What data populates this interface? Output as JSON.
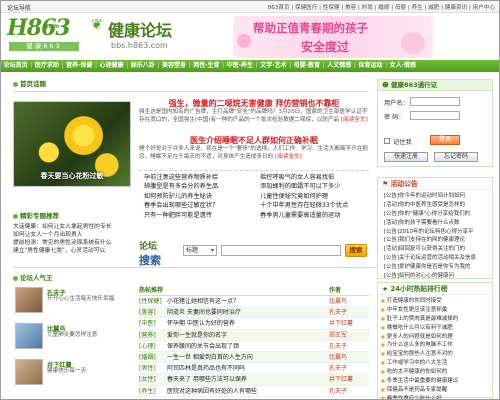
{
  "topbar": {
    "left": "论坛导航",
    "right": "863首页 | 保健医疗 | 性保健 | 美容 | 时尚 | 婚嫁 | 母婴 | 养生 | 减肥 | 健康资讯 | 用户中心"
  },
  "header": {
    "logo_big": "H863",
    "logo_small": ".com",
    "logo_zh": "健康863",
    "site_name": "健康论坛",
    "site_url": "bbs.h863.com",
    "banner_line1": "帮助正值青春期的孩子",
    "banner_line2": "安全度过"
  },
  "nav": [
    "论坛首页",
    "医疗求助",
    "营养·保健",
    "心理健康",
    "娱乐八卦",
    "美容塑身",
    "两性·生育",
    "中医·养生",
    "文学·艺术",
    "母婴·教育",
    "人文情感",
    "体育运动",
    "女人·情感"
  ],
  "featured": {
    "title": "首页话题",
    "photo_caption": "春天要当心花粉过敏",
    "headline1": "强生，微量的二噁烷无害健康  拜仿营销也不靠柜",
    "summary1": "强生这是国内知名的广告牌，主打品牌\"安全\"的品牌吗？3月20日，国家的卫生部医学认证不存在宽口的，全国强生(中国)有一种的产品的一个批次检验数据二噁烷，以防产品",
    "summary1_tail": "[阅读全文]",
    "headline2": "医生介绍睡眠不足人群如何正确补眠",
    "summary2": "睡个好觉对于许多人来说，现在是一个\"奢侈\"的选择，人们工作、学习、生活大都离不开在抱怨，睡眠不足在于每天的不适，对身体产生造成多日的",
    "summary2_tail": "[阅读全文]"
  },
  "news_left": [
    "孕前注意这些营养物质补给",
    "辨腹型是有多会分的养生品",
    "如何预防驴儿的养生秘诀",
    "春季会出现哪些过敏症状？",
    "只有一种肥胖可能是遗传"
  ],
  "news_right": [
    "摇控呼吸气的女人容易找伯",
    "添加蜂利的面霜不可以下多少",
    "儿童性便秘究竟如何护理",
    "十个中年男性存在轻微33个优点",
    "春季男儿童需要高适量的运动"
  ],
  "essence": {
    "title": "精彩专题推荐",
    "items": [
      "大话健康：如何让女人拿起男性的专长",
      "如何让女人一个月出现男人",
      "提前检测：常见的男性泌尿系统有什么",
      "建立\"男性健康七类\"，心灵活动可以"
    ]
  },
  "search": {
    "brand_top": "论坛",
    "brand_bottom": "搜索",
    "select_value": "标题",
    "button": "搜索"
  },
  "login": {
    "title": "健康863通行证",
    "user_label": "用户名：",
    "pass_label": "密  码：",
    "remember": "记住我",
    "login_btn": "登录",
    "reg_btn": "快速注册",
    "forgot_btn": "忘记密码"
  },
  "notice": {
    "title": "活动公告",
    "items": [
      "[公告]你今年的运动时间计划如何",
      "[活动]你的中医养生感受是怎样的",
      "[公告]你的\"健康\"心得分享给我们的",
      "[活动]你的孩子需要看什么点数",
      "[公告]2010年的论坛特色心得分享平",
      "[公告]我们支持在的网的健康理论",
      "[活动]回回复可以获得关注的门的",
      "[公告]关于论坛运营的活动相关及信息",
      "[公告]爱护健康你是否是你专为我的",
      "[公告]如何的对心心的健康问"
    ]
  },
  "ranking": {
    "title": "24小时热贴排行榜",
    "items": [
      "打造健康的你同时接受",
      "中年女性更应该注意卵巢",
      "肚子上的赘肉真是最难减掉的",
      "晚餐吃什么可以有利于减肥",
      "更多人的问题就是如何的理",
      "为什么这么多的电脑不工作",
      "给宝宝的那些人注意不对的",
      "工作或学习中的八大生活",
      "吃的太不健康的你如何的",
      "冬季生活中最重要的健康建议",
      "保健品不是药品专家提醒",
      "春季饮食应少吃什么好"
    ]
  },
  "people": {
    "title": "论坛人气王",
    "items": [
      {
        "name": "孔夫子",
        "desc": "开开心心生活每天快乐幸福"
      },
      {
        "name": "比翼鸟",
        "desc": "儿童肺炎要怎样注意"
      },
      {
        "name": "井下红薯",
        "desc": "健康快乐每一天"
      }
    ]
  },
  "hot": {
    "title": "热帖推荐",
    "col_author": "作者",
    "rows": [
      {
        "cat": "[性保健]",
        "title": "小花猪让她相信有这一点？",
        "author": "比翼鸟"
      },
      {
        "cat": "[美容]",
        "title": "阴道炎 夫妻间也要同时治疗",
        "author": "孔夫子"
      },
      {
        "cat": "[中医]",
        "title": "怀孕期 中医认为好的营养",
        "author": "井下红薯"
      },
      {
        "cat": "[营养]",
        "title": "爱你一生就是你的名字",
        "author": "郑王军"
      },
      {
        "cat": "[心理]",
        "title": "保养腰间的关节会出现了颈",
        "author": "孔夫子"
      },
      {
        "cat": "[婚姻]",
        "title": "一生一世 相爱到白首的人生方向",
        "author": "比翼鸟"
      },
      {
        "cat": "[男性]",
        "title": "阿司匹林是真药品也有不同吗",
        "author": "孔夫子"
      },
      {
        "cat": "[女性]",
        "title": "春天来了 用哪些方法可以保养",
        "author": "井下红薯"
      },
      {
        "cat": "[养生]",
        "title": "医院对这种病因有好处的人有哪些",
        "author": "孔夫子"
      }
    ]
  },
  "colors": {
    "brand_green": "#4f9c1a",
    "headline_red": "#d42020",
    "accent_orange": "#f2a500"
  }
}
